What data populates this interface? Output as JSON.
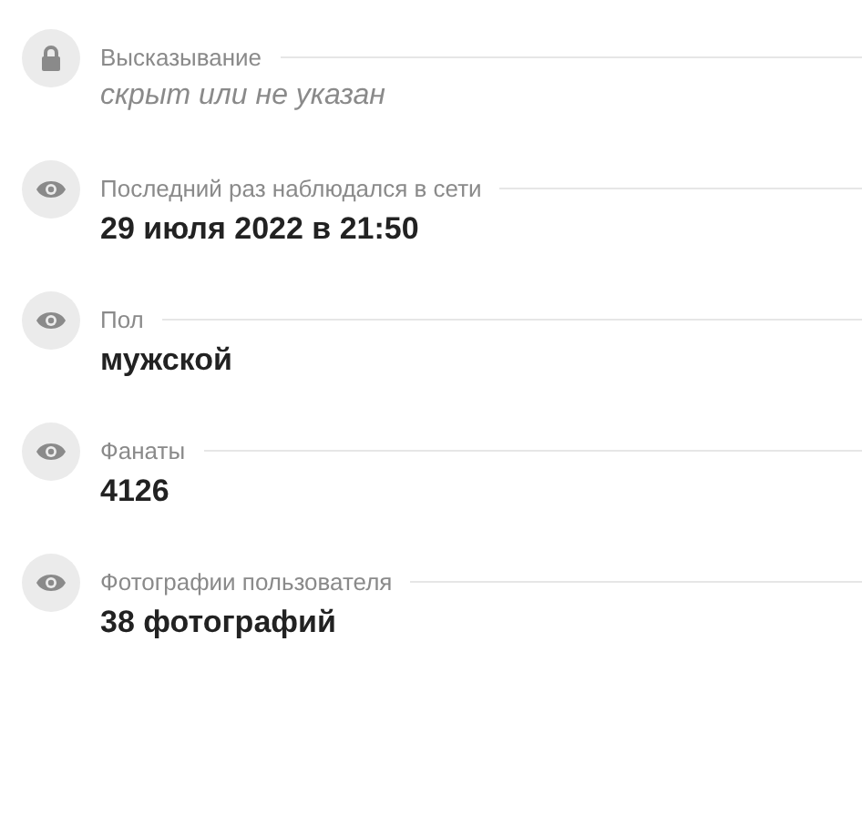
{
  "fields": [
    {
      "kind": "lock",
      "label": "Высказывание",
      "value": "скрыт или не указан",
      "hidden": true
    },
    {
      "kind": "eye",
      "label": "Последний раз наблюдался в сети",
      "value": "29 июля 2022 в 21:50",
      "hidden": false
    },
    {
      "kind": "eye",
      "label": "Пол",
      "value": "мужской",
      "hidden": false
    },
    {
      "kind": "eye",
      "label": "Фанаты",
      "value": "4126",
      "hidden": false
    },
    {
      "kind": "eye",
      "label": "Фотографии пользователя",
      "value": "38 фотографий",
      "hidden": false
    }
  ]
}
